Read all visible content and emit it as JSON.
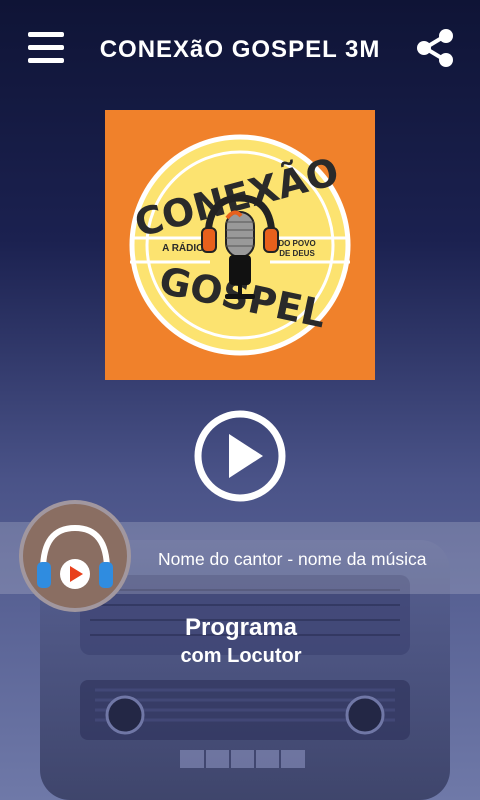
{
  "header": {
    "title": "CONEXãO GOSPEL 3M",
    "menu_icon": "hamburger-menu-icon",
    "share_icon": "share-icon"
  },
  "logo": {
    "line1": "CONEXÃO",
    "line2": "GOSPEL",
    "tagline_left": "A RÁDIO",
    "tagline_right_1": "DO POVO",
    "tagline_right_2": "DE DEUS",
    "bg_color": "#f0812b",
    "badge_color": "#fce370"
  },
  "player": {
    "play_icon": "play-icon",
    "now_playing": "Nome do cantor - nome da música",
    "avatar_icon": "headphones-icon"
  },
  "program": {
    "title": "Programa",
    "host": "com Locutor"
  }
}
